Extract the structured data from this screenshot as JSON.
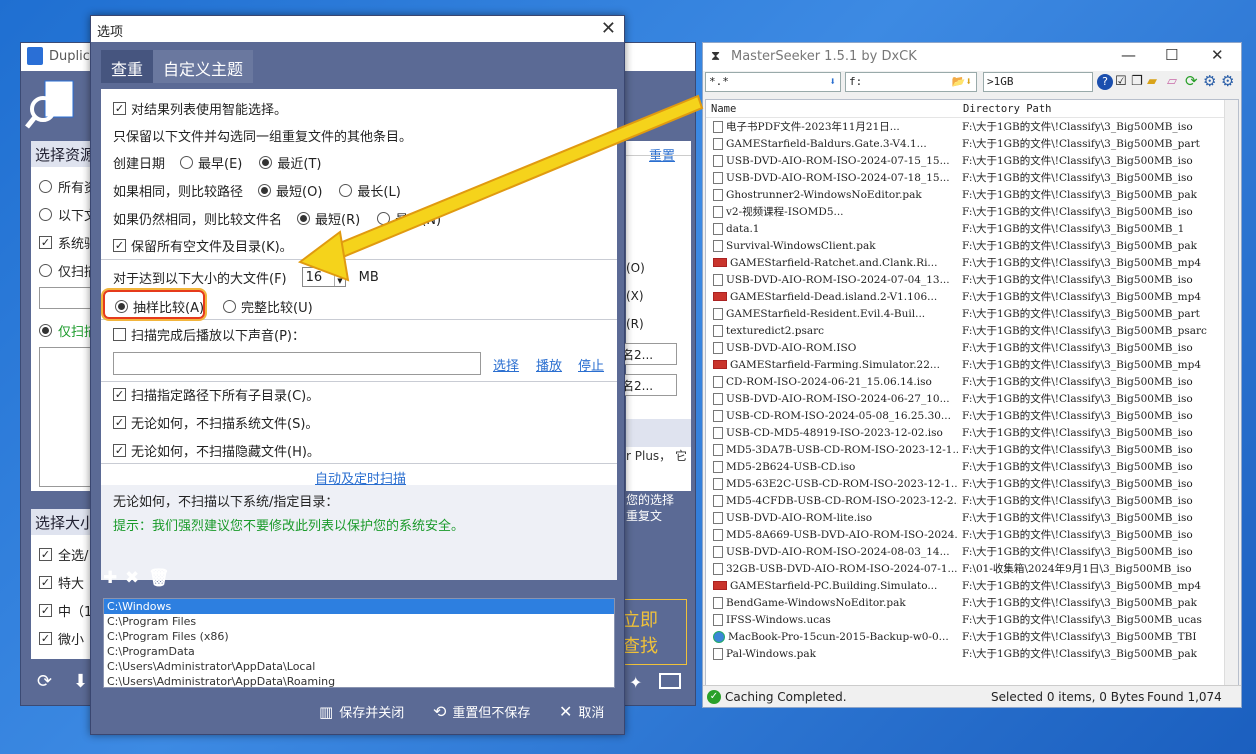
{
  "dup": {
    "title": "Duplicat",
    "section_select": "选择资源",
    "reset": "重置",
    "opts": [
      "所有资",
      "以下文",
      "系统驱",
      "仅扫描",
      "仅扫描"
    ],
    "letters": [
      "(O)",
      "(X)",
      "(R)"
    ],
    "names": [
      "名2...",
      "名2..."
    ],
    "plus": "r Plus， 它",
    "desc1": "您的选择",
    "desc2": "重复文",
    "size_hdr": "选择大小",
    "size_opts": [
      "全选/",
      "特大",
      "中（1",
      "微小"
    ],
    "start1": "立即",
    "start2": "查找"
  },
  "opt": {
    "title": "选项",
    "tabs": [
      "查重",
      "自定义主题"
    ],
    "smart": "对结果列表使用智能选择。",
    "keep_note": "只保留以下文件并勾选同一组重复文件的其他条目。",
    "created": "创建日期",
    "oldest": "最早(E)",
    "newest": "最近(T)",
    "same_path": "如果相同，则比较路径",
    "shortest_o": "最短(O)",
    "longest": "最长(L)",
    "same_name": "如果仍然相同，则比较文件名",
    "shortest_r": "最短(R)",
    "longest_n": "最长(N)",
    "keep_empty": "保留所有空文件及目录(K)。",
    "large_label": "对于达到以下大小的大文件(F)",
    "large_value": "16",
    "mb": "MB",
    "sample": "抽样比较(A)",
    "full": "完整比较(U)",
    "sound": "扫描完成后播放以下声音(P)：",
    "choose": "选择",
    "play": "播放",
    "stop": "停止",
    "subdirs": "扫描指定路径下所有子目录(C)。",
    "no_sys": "无论如何，不扫描系统文件(S)。",
    "no_hidden": "无论如何，不扫描隐藏文件(H)。",
    "auto": "自动及定时扫描",
    "exclude": "无论如何，不扫描以下系统/指定目录：",
    "tip": "提示：我们强烈建议您不要修改此列表以保护您的系统安全。",
    "dirs": [
      "C:\\Windows",
      "C:\\Program Files",
      "C:\\Program Files (x86)",
      "C:\\ProgramData",
      "C:\\Users\\Administrator\\AppData\\Local",
      "C:\\Users\\Administrator\\AppData\\Roaming"
    ],
    "save": "保存并关闭",
    "reset_nosave": "重置但不保存",
    "cancel": "取消"
  },
  "ms": {
    "title": "MasterSeeker 1.5.1 by DxCK",
    "filter_name": "*.*",
    "filter_path": "f:",
    "filter_size": ">1GB",
    "col_name": "Name",
    "col_path": "Directory Path",
    "rows": [
      [
        "file",
        "电子书PDF文件-2023年11月21日...",
        "F:\\大于1GB的文件\\!Classify\\3_Big500MB_iso"
      ],
      [
        "file",
        "GAMEStarfield-Baldurs.Gate.3-V4.1...",
        "F:\\大于1GB的文件\\!Classify\\3_Big500MB_part"
      ],
      [
        "file",
        "USB-DVD-AIO-ROM-ISO-2024-07-15_15...",
        "F:\\大于1GB的文件\\!Classify\\3_Big500MB_iso"
      ],
      [
        "file",
        "USB-DVD-AIO-ROM-ISO-2024-07-18_15...",
        "F:\\大于1GB的文件\\!Classify\\3_Big500MB_iso"
      ],
      [
        "file",
        "Ghostrunner2-WindowsNoEditor.pak",
        "F:\\大于1GB的文件\\!Classify\\3_Big500MB_pak"
      ],
      [
        "file",
        "v2-视频课程-ISOMD5...",
        "F:\\大于1GB的文件\\!Classify\\3_Big500MB_iso"
      ],
      [
        "file",
        "data.1",
        "F:\\大于1GB的文件\\!Classify\\3_Big500MB_1"
      ],
      [
        "file",
        "Survival-WindowsClient.pak",
        "F:\\大于1GB的文件\\!Classify\\3_Big500MB_pak"
      ],
      [
        "mp4",
        "GAMEStarfield-Ratchet.and.Clank.Ri...",
        "F:\\大于1GB的文件\\!Classify\\3_Big500MB_mp4"
      ],
      [
        "file",
        "USB-DVD-AIO-ROM-ISO-2024-07-04_13...",
        "F:\\大于1GB的文件\\!Classify\\3_Big500MB_iso"
      ],
      [
        "mp4",
        "GAMEStarfield-Dead.island.2-V1.106...",
        "F:\\大于1GB的文件\\!Classify\\3_Big500MB_mp4"
      ],
      [
        "file",
        "GAMEStarfield-Resident.Evil.4-Buil...",
        "F:\\大于1GB的文件\\!Classify\\3_Big500MB_part"
      ],
      [
        "file",
        "texturedict2.psarc",
        "F:\\大于1GB的文件\\!Classify\\3_Big500MB_psarc"
      ],
      [
        "file",
        "USB-DVD-AIO-ROM.ISO",
        "F:\\大于1GB的文件\\!Classify\\3_Big500MB_iso"
      ],
      [
        "mp4",
        "GAMEStarfield-Farming.Simulator.22...",
        "F:\\大于1GB的文件\\!Classify\\3_Big500MB_mp4"
      ],
      [
        "file",
        "CD-ROM-ISO-2024-06-21_15.06.14.iso",
        "F:\\大于1GB的文件\\!Classify\\3_Big500MB_iso"
      ],
      [
        "file",
        "USB-DVD-AIO-ROM-ISO-2024-06-27_10...",
        "F:\\大于1GB的文件\\!Classify\\3_Big500MB_iso"
      ],
      [
        "file",
        "USB-CD-ROM-ISO-2024-05-08_16.25.30...",
        "F:\\大于1GB的文件\\!Classify\\3_Big500MB_iso"
      ],
      [
        "file",
        "USB-CD-MD5-48919-ISO-2023-12-02.iso",
        "F:\\大于1GB的文件\\!Classify\\3_Big500MB_iso"
      ],
      [
        "file",
        "MD5-3DA7B-USB-CD-ROM-ISO-2023-12-1...",
        "F:\\大于1GB的文件\\!Classify\\3_Big500MB_iso"
      ],
      [
        "file",
        "MD5-2B624-USB-CD.iso",
        "F:\\大于1GB的文件\\!Classify\\3_Big500MB_iso"
      ],
      [
        "file",
        "MD5-63E2C-USB-CD-ROM-ISO-2023-12-1...",
        "F:\\大于1GB的文件\\!Classify\\3_Big500MB_iso"
      ],
      [
        "file",
        "MD5-4CFDB-USB-CD-ROM-ISO-2023-12-2...",
        "F:\\大于1GB的文件\\!Classify\\3_Big500MB_iso"
      ],
      [
        "file",
        "USB-DVD-AIO-ROM-lite.iso",
        "F:\\大于1GB的文件\\!Classify\\3_Big500MB_iso"
      ],
      [
        "file",
        "MD5-8A669-USB-DVD-AIO-ROM-ISO-2024...",
        "F:\\大于1GB的文件\\!Classify\\3_Big500MB_iso"
      ],
      [
        "file",
        "USB-DVD-AIO-ROM-ISO-2024-08-03_14...",
        "F:\\大于1GB的文件\\!Classify\\3_Big500MB_iso"
      ],
      [
        "file",
        "32GB-USB-DVD-AIO-ROM-ISO-2024-07-1...",
        "F:\\01-收集箱\\2024年9月1日\\3_Big500MB_iso"
      ],
      [
        "mp4",
        "GAMEStarfield-PC.Building.Simulato...",
        "F:\\大于1GB的文件\\!Classify\\3_Big500MB_mp4"
      ],
      [
        "file",
        "BendGame-WindowsNoEditor.pak",
        "F:\\大于1GB的文件\\!Classify\\3_Big500MB_pak"
      ],
      [
        "file",
        "IFSS-Windows.ucas",
        "F:\\大于1GB的文件\\!Classify\\3_Big500MB_ucas"
      ],
      [
        "tbi",
        "MacBook-Pro-15cun-2015-Backup-w0-0...",
        "F:\\大于1GB的文件\\!Classify\\3_Big500MB_TBI"
      ],
      [
        "file",
        "Pal-Windows.pak",
        "F:\\大于1GB的文件\\!Classify\\3_Big500MB_pak"
      ]
    ],
    "status": "Caching Completed.",
    "selected": "Selected 0 items, 0 Bytes",
    "found": "Found 1,074"
  },
  "colors": {
    "accent": "#5b6a95",
    "arrow": "#f5d31b",
    "highlight": "#e63a1b"
  }
}
